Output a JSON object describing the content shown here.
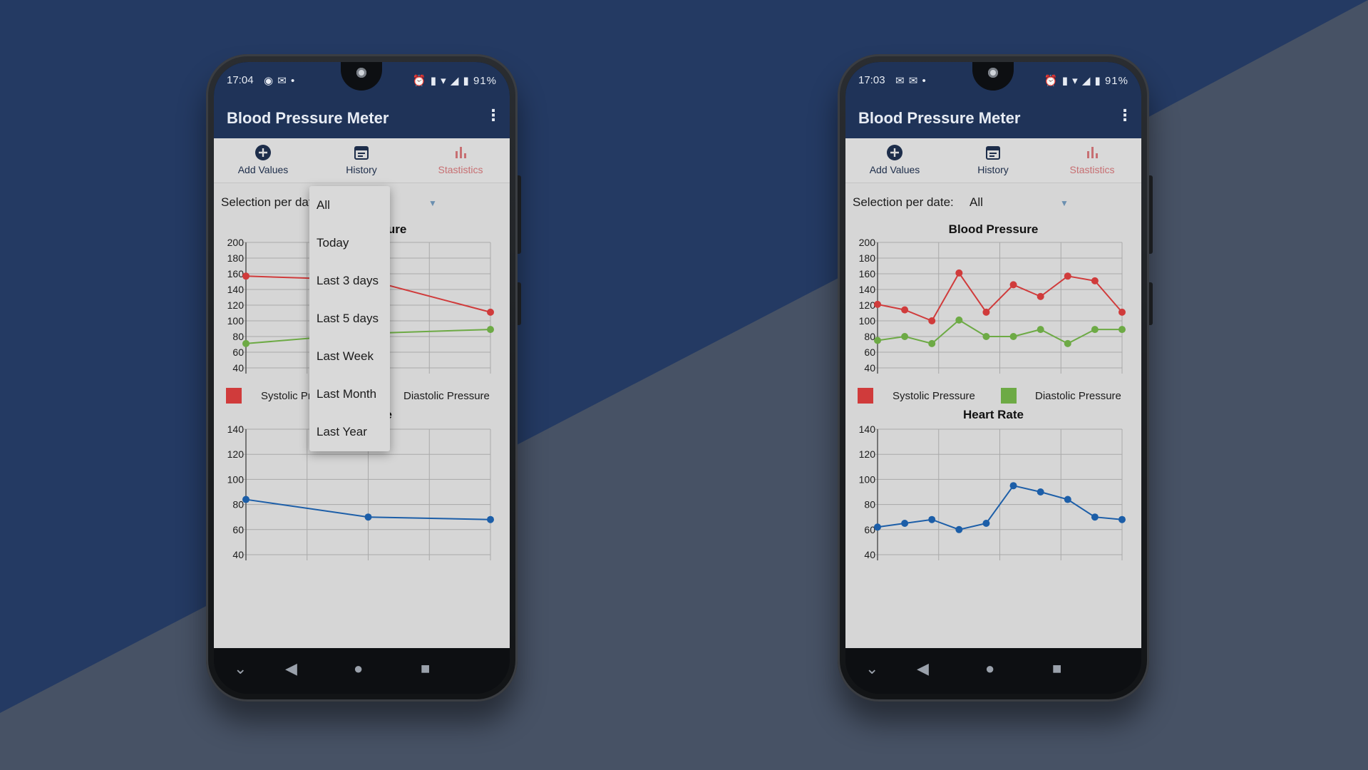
{
  "colors": {
    "bg_dark": "#243a63",
    "bg_light": "#475265",
    "app_bar": "#1f3358",
    "systolic": "#d03b3b",
    "diastolic": "#6daa45",
    "heart": "#1c5ea8",
    "active_tab": "#c76f72"
  },
  "phones": [
    {
      "status": {
        "time": "17:04",
        "icons_left": "◉ ✉ •",
        "icons_right": "⏰ ▮ ▾ ◢ ▮ 91%"
      },
      "app_title": "Blood Pressure Meter",
      "menu_icon": "⋮",
      "tabs": [
        {
          "label": "Add Values",
          "icon": "add-circle-icon"
        },
        {
          "label": "History",
          "icon": "calendar-icon"
        },
        {
          "label": "Stastistics",
          "icon": "bar-chart-icon"
        }
      ],
      "selection_label": "Selection per date:",
      "selection_value": "",
      "dropdown_open": true,
      "dropdown_options": [
        "All",
        "Today",
        "Last 3 days",
        "Last 5 days",
        "Last Week",
        "Last Month",
        "Last Year"
      ],
      "bp_title": "Blood Pressure",
      "hr_title": "Heart Rate",
      "legend": [
        "Systolic Pressure",
        "Diastolic Pressure"
      ],
      "nav": [
        "⌄",
        "◀",
        "●",
        "■"
      ]
    },
    {
      "status": {
        "time": "17:03",
        "icons_left": "✉ ✉ •",
        "icons_right": "⏰ ▮ ▾ ◢ ▮ 91%"
      },
      "app_title": "Blood Pressure Meter",
      "menu_icon": "⋮",
      "tabs": [
        {
          "label": "Add Values",
          "icon": "add-circle-icon"
        },
        {
          "label": "History",
          "icon": "calendar-icon"
        },
        {
          "label": "Stastistics",
          "icon": "bar-chart-icon"
        }
      ],
      "selection_label": "Selection per date:",
      "selection_value": "All",
      "dropdown_open": false,
      "dropdown_options": [],
      "bp_title": "Blood Pressure",
      "hr_title": "Heart Rate",
      "legend": [
        "Systolic Pressure",
        "Diastolic Pressure"
      ],
      "nav": [
        "⌄",
        "◀",
        "●",
        "■"
      ]
    }
  ],
  "chart_data": [
    {
      "type": "line",
      "title": "Blood Pressure",
      "ylim": [
        40,
        200
      ],
      "yticks": [
        40,
        60,
        80,
        100,
        120,
        140,
        160,
        180,
        200
      ],
      "x": [
        0,
        0.5,
        1
      ],
      "series": [
        {
          "name": "Systolic Pressure",
          "values": [
            157,
            152,
            111
          ]
        },
        {
          "name": "Diastolic Pressure",
          "values": [
            71,
            84,
            89
          ]
        }
      ]
    },
    {
      "type": "line",
      "title": "Heart Rate",
      "ylim": [
        40,
        140
      ],
      "yticks": [
        40,
        60,
        80,
        100,
        120,
        140
      ],
      "x": [
        0,
        0.5,
        1
      ],
      "series": [
        {
          "values": [
            84,
            70,
            68
          ]
        }
      ]
    },
    {
      "type": "line",
      "title": "Blood Pressure",
      "ylim": [
        40,
        200
      ],
      "yticks": [
        40,
        60,
        80,
        100,
        120,
        140,
        160,
        180,
        200
      ],
      "x": [
        0,
        1,
        2,
        3,
        4,
        5,
        6,
        7,
        8,
        9
      ],
      "series": [
        {
          "name": "Systolic Pressure",
          "values": [
            121,
            114,
            100,
            161,
            111,
            146,
            131,
            157,
            151,
            111
          ]
        },
        {
          "name": "Diastolic Pressure",
          "values": [
            75,
            80,
            71,
            101,
            80,
            80,
            89,
            71,
            89,
            89
          ]
        }
      ]
    },
    {
      "type": "line",
      "title": "Heart Rate",
      "ylim": [
        40,
        140
      ],
      "yticks": [
        40,
        60,
        80,
        100,
        120,
        140
      ],
      "x": [
        0,
        1,
        2,
        3,
        4,
        5,
        6,
        7,
        8,
        9
      ],
      "series": [
        {
          "values": [
            62,
            65,
            68,
            60,
            65,
            95,
            90,
            84,
            70,
            68
          ]
        }
      ]
    }
  ]
}
